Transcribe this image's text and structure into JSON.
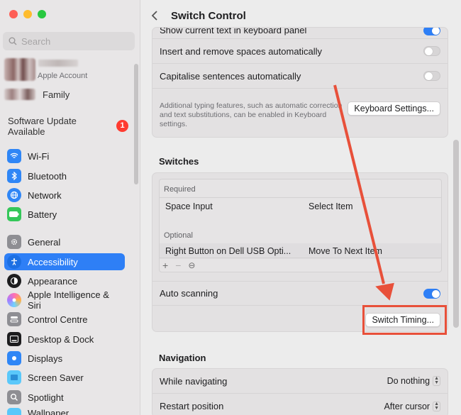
{
  "window": {
    "title": "Switch Control",
    "traffic_colors": [
      "#fe5f57",
      "#febc2e",
      "#28c840"
    ]
  },
  "sidebar": {
    "search_placeholder": "Search",
    "account_label": "Apple Account",
    "family_label": "Family",
    "software_update": "Software Update Available",
    "software_update_badge": "1",
    "items": [
      {
        "label": "Wi-Fi",
        "icon": "wifi-icon",
        "color": "#2f86f6"
      },
      {
        "label": "Bluetooth",
        "icon": "bluetooth-icon",
        "color": "#2f86f6"
      },
      {
        "label": "Network",
        "icon": "globe-icon",
        "color": "#2f86f6"
      },
      {
        "label": "Battery",
        "icon": "battery-icon",
        "color": "#34c759"
      },
      {
        "label": "General",
        "icon": "gear-icon",
        "color": "#8e8e93"
      },
      {
        "label": "Accessibility",
        "icon": "accessibility-icon",
        "color": "#2f86f6"
      },
      {
        "label": "Appearance",
        "icon": "appearance-icon",
        "color": "#1d1d1f"
      },
      {
        "label": "Apple Intelligence & Siri",
        "icon": "siri-icon",
        "color": "#e06bd8"
      },
      {
        "label": "Control Centre",
        "icon": "control-centre-icon",
        "color": "#8e8e93"
      },
      {
        "label": "Desktop & Dock",
        "icon": "dock-icon",
        "color": "#1d1d1f"
      },
      {
        "label": "Displays",
        "icon": "display-icon",
        "color": "#2f86f6"
      },
      {
        "label": "Screen Saver",
        "icon": "screensaver-icon",
        "color": "#5ac8fa"
      },
      {
        "label": "Spotlight",
        "icon": "spotlight-icon",
        "color": "#8e8e93"
      },
      {
        "label": "Wallpaper",
        "icon": "wallpaper-icon",
        "color": "#5ac8fa"
      }
    ]
  },
  "typing": {
    "show_current_text": "Show current text in keyboard panel",
    "insert_spaces": "Insert and remove spaces automatically",
    "capitalise": "Capitalise sentences automatically",
    "note": "Additional typing features, such as automatic correction and text substitutions, can be enabled in Keyboard settings.",
    "keyboard_settings_btn": "Keyboard Settings..."
  },
  "switches": {
    "heading": "Switches",
    "required_label": "Required",
    "optional_label": "Optional",
    "rows": [
      {
        "switch": "Space Input",
        "action": "Select Item"
      },
      {
        "switch": "Right Button on Dell USB Opti...",
        "action": "Move To Next Item"
      }
    ],
    "tool_add": "+",
    "tool_remove": "−",
    "tool_more": "⊖",
    "auto_scanning": "Auto scanning",
    "switch_timing_btn": "Switch Timing..."
  },
  "navigation": {
    "heading": "Navigation",
    "while_navigating": "While navigating",
    "while_navigating_value": "Do nothing",
    "restart_position": "Restart position",
    "restart_position_value": "After cursor"
  },
  "annotation_color": "#e8503a"
}
